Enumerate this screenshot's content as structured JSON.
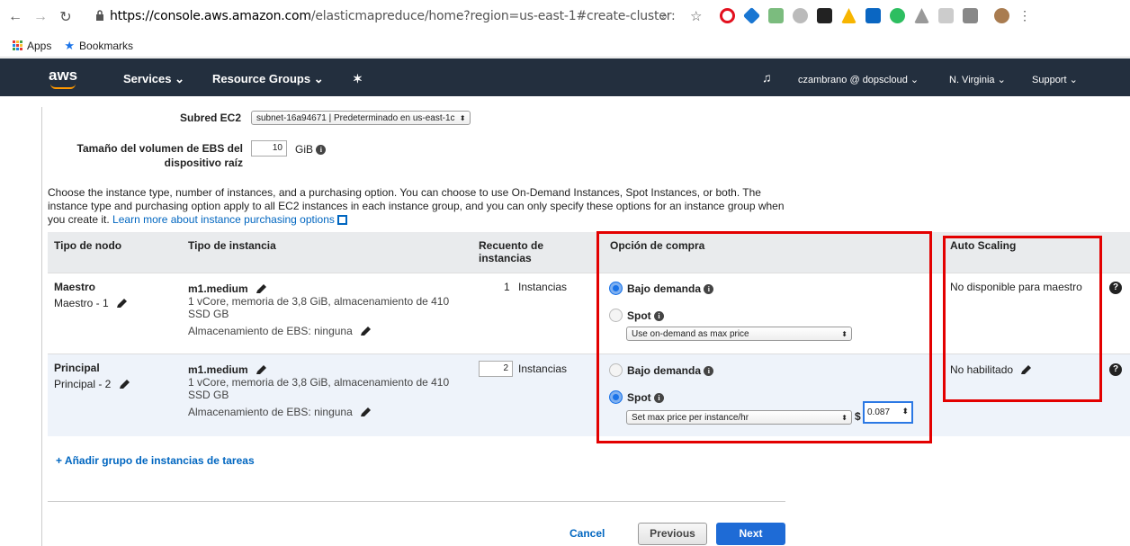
{
  "browser": {
    "url_host": "https://console.aws.amazon.com",
    "url_rest": "/elasticmapreduce/home?region=us-east-1#create-cluster:",
    "bookmarks": [
      {
        "label": "Apps"
      },
      {
        "label": "Bookmarks"
      }
    ]
  },
  "aws_nav": {
    "logo": "aws",
    "services": "Services",
    "resource_groups": "Resource Groups",
    "account": "czambrano @ dopscloud",
    "region": "N. Virginia",
    "support": "Support"
  },
  "form": {
    "subnet_label": "Subred EC2",
    "subnet_value": "subnet-16a94671 | Predeterminado en us-east-1c",
    "ebs_label_line1": "Tamaño del volumen de EBS del",
    "ebs_label_line2": "dispositivo raíz",
    "ebs_value": "10",
    "ebs_unit": "GiB"
  },
  "description": {
    "text": "Choose the instance type, number of instances, and a purchasing option. You can choose to use On-Demand Instances, Spot Instances, or both. The instance type and purchasing option apply to all EC2 instances in each instance group, and you can only specify these options for an instance group when you create it.",
    "link": "Learn more about instance purchasing options"
  },
  "table": {
    "headers": {
      "node_type": "Tipo de nodo",
      "instance_type": "Tipo de instancia",
      "count_line1": "Recuento de",
      "count_line2": "instancias",
      "purchase": "Opción de compra",
      "autoscaling": "Auto Scaling"
    },
    "rows": [
      {
        "node": "Maestro",
        "node_sub": "Maestro - 1",
        "instance": "m1.medium",
        "spec_line1": "1 vCore, memoria de 3,8 GiB, almacenamiento de 410",
        "spec_line2": "SSD GB",
        "ebs": "Almacenamiento de EBS:  ninguna",
        "count": "1",
        "count_unit": "Instancias",
        "on_demand": "Bajo demanda",
        "spot": "Spot",
        "spot_option": "Use on-demand as max price",
        "autoscaling": "No disponible para maestro"
      },
      {
        "node": "Principal",
        "node_sub": "Principal - 2",
        "instance": "m1.medium",
        "spec_line1": "1 vCore, memoria de 3,8 GiB, almacenamiento de 410",
        "spec_line2": "SSD GB",
        "ebs": "Almacenamiento de EBS:  ninguna",
        "count": "2",
        "count_unit": "Instancias",
        "on_demand": "Bajo demanda",
        "spot": "Spot",
        "spot_option": "Set max price per instance/hr",
        "currency": "$",
        "price": "0.087",
        "autoscaling": "No habilitado"
      }
    ]
  },
  "add_task_group": "+ Añadir grupo de instancias de tareas",
  "footer": {
    "cancel": "Cancel",
    "previous": "Previous",
    "next": "Next"
  },
  "colors": {
    "aws_nav_bg": "#232f3e",
    "next_button": "#1e6bd6",
    "highlight_box": "#e30000"
  }
}
